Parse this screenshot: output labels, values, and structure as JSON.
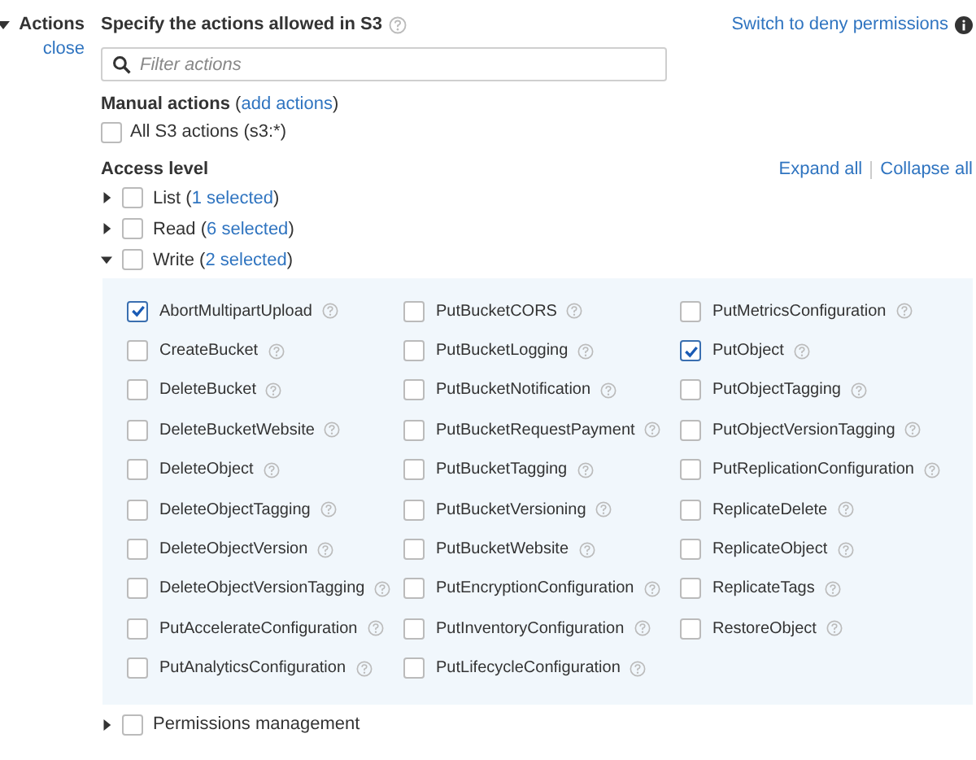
{
  "section": {
    "title": "Actions",
    "expanded": true,
    "close_link": "close"
  },
  "heading": "Specify the actions allowed in S3",
  "switch_link": "Switch to deny permissions",
  "filter": {
    "placeholder": "Filter actions"
  },
  "manual": {
    "title": "Manual actions",
    "before": " (",
    "link": "add actions",
    "after": ")",
    "all": {
      "label": "All S3 actions (s3:*)",
      "checked": false
    }
  },
  "access": {
    "title": "Access level",
    "expand_all": "Expand all",
    "collapse_all": "Collapse all",
    "levels": [
      {
        "label": "List",
        "before": " (",
        "link": "1 selected",
        "after": ")",
        "checked": false,
        "expanded": false
      },
      {
        "label": "Read",
        "before": " (",
        "link": "6 selected",
        "after": ")",
        "checked": false,
        "expanded": false
      },
      {
        "label": "Write",
        "before": " (",
        "link": "2 selected",
        "after": ")",
        "checked": false,
        "expanded": true,
        "actions": [
          {
            "label": "AbortMultipartUpload",
            "checked": true
          },
          {
            "label": "CreateBucket",
            "checked": false
          },
          {
            "label": "DeleteBucket",
            "checked": false
          },
          {
            "label": "DeleteBucketWebsite",
            "checked": false
          },
          {
            "label": "DeleteObject",
            "checked": false
          },
          {
            "label": "DeleteObjectTagging",
            "checked": false
          },
          {
            "label": "DeleteObjectVersion",
            "checked": false
          },
          {
            "label": "DeleteObjectVersionTagging",
            "checked": false
          },
          {
            "label": "PutAccelerateConfiguration",
            "checked": false
          },
          {
            "label": "PutAnalyticsConfiguration",
            "checked": false
          },
          {
            "label": "PutBucketCORS",
            "checked": false
          },
          {
            "label": "PutBucketLogging",
            "checked": false
          },
          {
            "label": "PutBucketNotification",
            "checked": false
          },
          {
            "label": "PutBucketRequestPayment",
            "checked": false
          },
          {
            "label": "PutBucketTagging",
            "checked": false
          },
          {
            "label": "PutBucketVersioning",
            "checked": false
          },
          {
            "label": "PutBucketWebsite",
            "checked": false
          },
          {
            "label": "PutEncryptionConfiguration",
            "checked": false
          },
          {
            "label": "PutInventoryConfiguration",
            "checked": false
          },
          {
            "label": "PutLifecycleConfiguration",
            "checked": false
          },
          {
            "label": "PutMetricsConfiguration",
            "checked": false
          },
          {
            "label": "PutObject",
            "checked": true
          },
          {
            "label": "PutObjectTagging",
            "checked": false
          },
          {
            "label": "PutObjectVersionTagging",
            "checked": false
          },
          {
            "label": "PutReplicationConfiguration",
            "checked": false
          },
          {
            "label": "ReplicateDelete",
            "checked": false
          },
          {
            "label": "ReplicateObject",
            "checked": false
          },
          {
            "label": "ReplicateTags",
            "checked": false
          },
          {
            "label": "RestoreObject",
            "checked": false
          }
        ]
      },
      {
        "label": "Permissions management",
        "checked": false,
        "expanded": false
      }
    ]
  }
}
